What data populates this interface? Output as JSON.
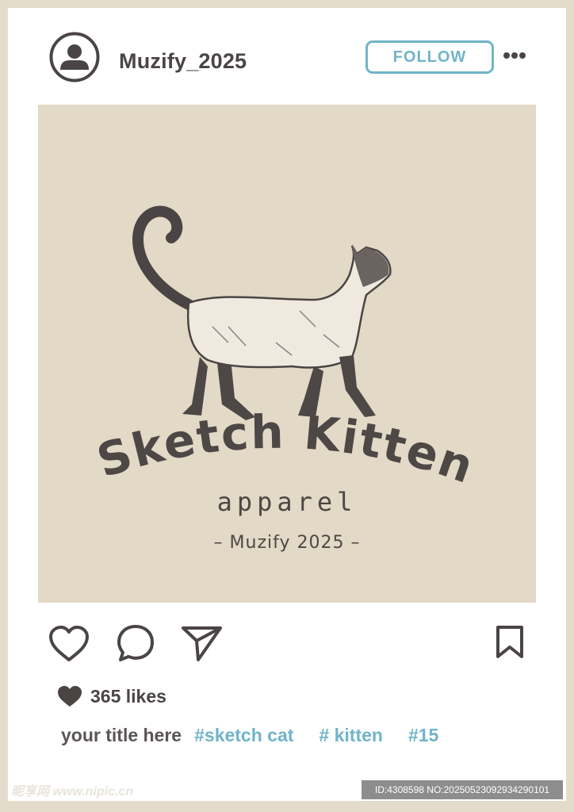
{
  "post": {
    "username": "Muzify_2025",
    "follow_label": "FOLLOW",
    "image": {
      "logo_title": "Sketch Kitten",
      "logo_subtitle": "apparel",
      "logo_credit": "– Muzify 2025 –"
    },
    "likes": "365 likes",
    "caption": {
      "title": "your title here",
      "tags": [
        "#sketch cat",
        "# kitten",
        "#15"
      ]
    }
  },
  "watermark": {
    "left": "昵享网 www.nipic.cn",
    "right": "ID:4308598 NO:20250523092934290101"
  },
  "icons": {
    "avatar": "user-avatar-icon",
    "more": "more-dots-icon",
    "like": "heart-icon",
    "comment": "comment-bubble-icon",
    "share": "paper-plane-icon",
    "save": "bookmark-icon"
  },
  "colors": {
    "accent": "#71b4c8",
    "text": "#4a4544",
    "frame": "#e4dccb",
    "photo_bg": "#e2d9c6"
  }
}
